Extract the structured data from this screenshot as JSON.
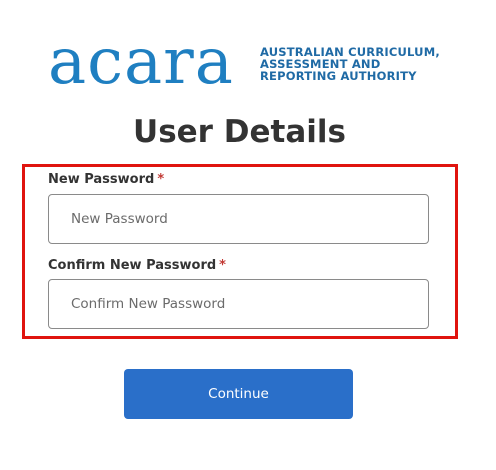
{
  "logo": {
    "wordmark": "acara",
    "tagline": [
      "AUSTRALIAN CURRICULUM,",
      "ASSESSMENT AND",
      "REPORTING AUTHORITY"
    ]
  },
  "page_title": "User Details",
  "form": {
    "new_password": {
      "label": "New Password",
      "required_marker": "*",
      "placeholder": "New Password",
      "value": ""
    },
    "confirm_password": {
      "label": "Confirm New Password",
      "required_marker": "*",
      "placeholder": "Confirm New Password",
      "value": ""
    }
  },
  "continue_button": {
    "label": "Continue"
  },
  "colors": {
    "brand_blue": "#1f7fc1",
    "button_blue": "#2a6fc9",
    "highlight_red": "#e0140f",
    "required_red": "#c23934"
  }
}
